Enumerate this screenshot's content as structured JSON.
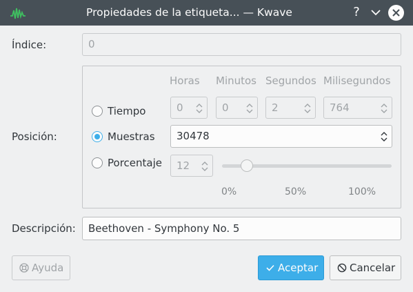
{
  "window": {
    "title": "Propiedades de la etiqueta... — Kwave",
    "help_glyph": "?"
  },
  "form": {
    "index_label": "Índice:",
    "index_value": "0",
    "position_label": "Posición:",
    "description_label": "Descripción:",
    "description_value": "Beethoven - Symphony No. 5"
  },
  "position": {
    "column_headers": [
      "Horas",
      "Minutos",
      "Segundos",
      "Milisegundos"
    ],
    "time_label": "Tiempo",
    "time_values": [
      "0",
      "0",
      "2",
      "764"
    ],
    "samples_label": "Muestras",
    "samples_value": "30478",
    "percent_label": "Porcentaje",
    "percent_value": "12",
    "slider_ticks": [
      "0%",
      "50%",
      "100%"
    ],
    "slider_level_percent": 12,
    "selected": "Muestras"
  },
  "buttons": {
    "help": "Ayuda",
    "ok": "Aceptar",
    "cancel": "Cancelar"
  },
  "colors": {
    "titlebar": "#475057",
    "accent": "#3daee9",
    "background": "#eff0f1"
  },
  "icons": {
    "app": "kwave-waveform-icon",
    "help": "help-icon",
    "minimize": "chevron-down-icon",
    "close": "close-icon",
    "ok": "checkmark-icon",
    "cancel": "cancel-icon",
    "lifebuoy": "lifebuoy-icon"
  }
}
